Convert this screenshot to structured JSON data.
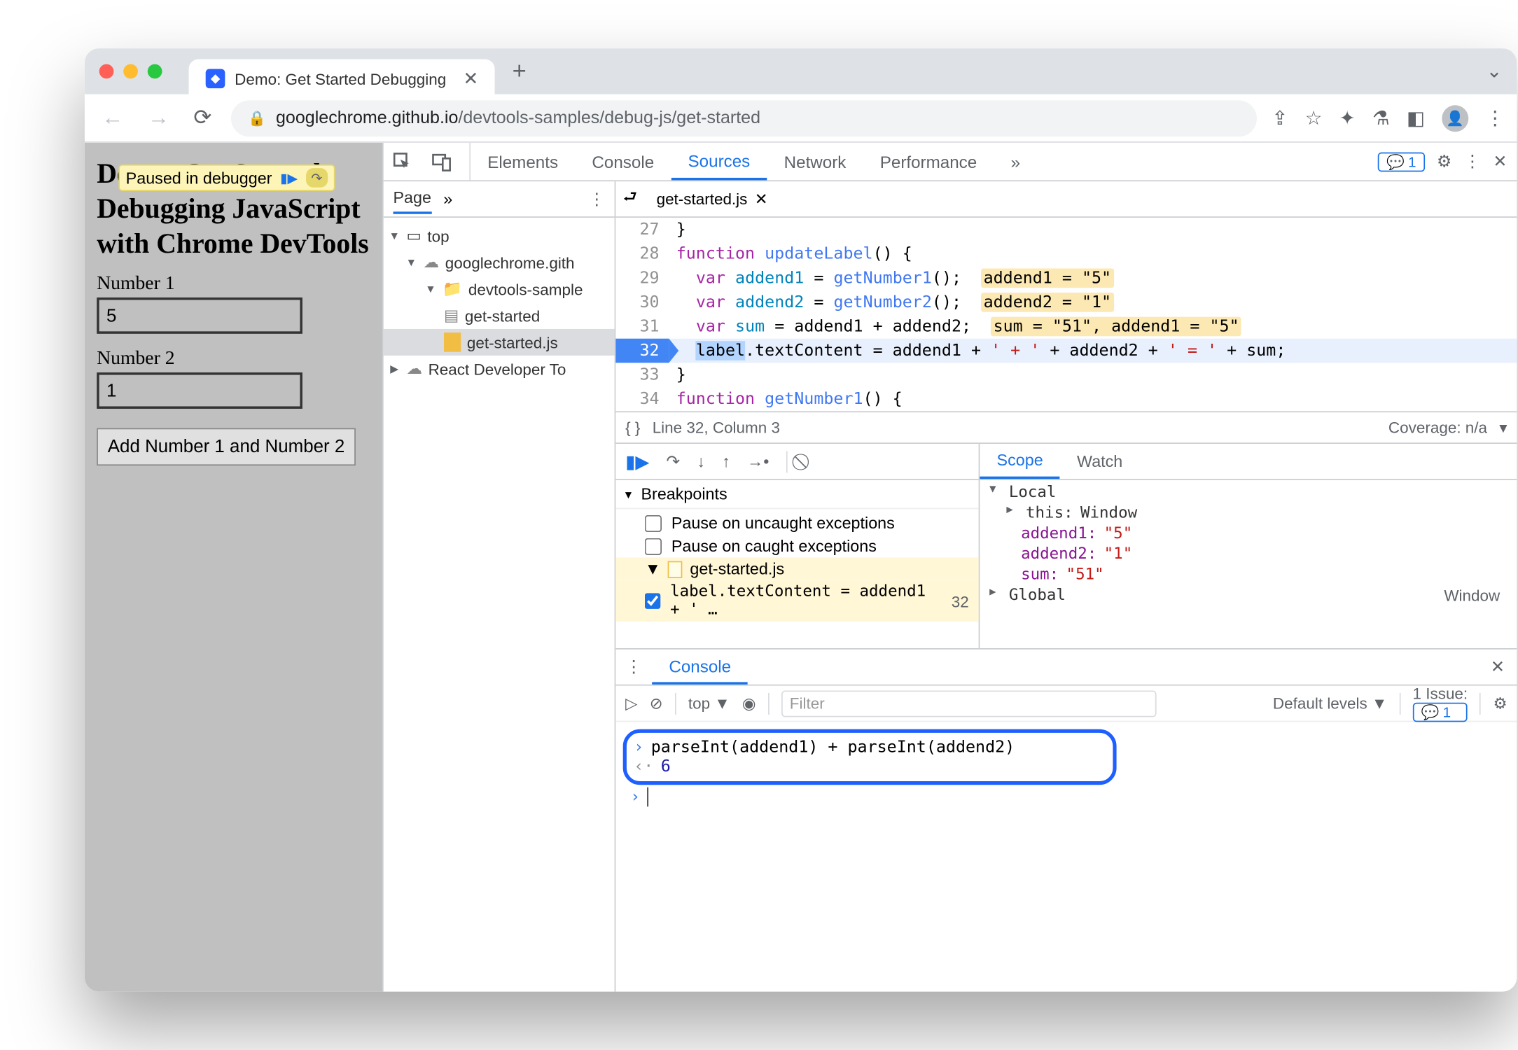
{
  "browser": {
    "tab_title": "Demo: Get Started Debugging",
    "url_host": "googlechrome.github.io",
    "url_path": "/devtools-samples/debug-js/get-started"
  },
  "paused_badge": "Paused in debugger",
  "page": {
    "heading": "Demo: Get Started Debugging JavaScript with Chrome DevTools",
    "label1": "Number 1",
    "value1": "5",
    "label2": "Number 2",
    "value2": "1",
    "button": "Add Number 1 and Number 2"
  },
  "devtools": {
    "tabs": [
      "Elements",
      "Console",
      "Sources",
      "Network",
      "Performance"
    ],
    "active_tab": "Sources",
    "issue_count": "1"
  },
  "nav": {
    "head": "Page",
    "top": "top",
    "domain": "googlechrome.gith",
    "folder": "devtools-sample",
    "file_html": "get-started",
    "file_js": "get-started.js",
    "react": "React Developer To"
  },
  "editor": {
    "open_file": "get-started.js",
    "coverage": "Coverage: n/a",
    "cursor": "Line 32, Column 3",
    "lines": [
      {
        "n": "27",
        "html": "}"
      },
      {
        "n": "28",
        "html": "<span class='kw'>function</span> <span class='fn'>updateLabel</span>() {"
      },
      {
        "n": "29",
        "html": "  <span class='kw'>var</span> <span class='var'>addend1</span> = <span class='fn'>getNumber1</span>();  <span class='hl'>addend1 = \"5\"</span>"
      },
      {
        "n": "30",
        "html": "  <span class='kw'>var</span> <span class='var'>addend2</span> = <span class='fn'>getNumber2</span>();  <span class='hl'>addend2 = \"1\"</span>"
      },
      {
        "n": "31",
        "html": "  <span class='kw'>var</span> <span class='var'>sum</span> = addend1 + addend2;  <span class='hl'>sum = \"51\", addend1 = \"5\"</span>"
      },
      {
        "n": "32",
        "html": "  <span class='sel-token'>label</span>.textContent = addend1 + <span class='str'>' + '</span> + addend2 + <span class='str'>' = '</span> + sum;",
        "cur": true
      },
      {
        "n": "33",
        "html": "}"
      },
      {
        "n": "34",
        "html": "<span class='kw'>function</span> <span class='fn'>getNumber1</span>() {"
      }
    ]
  },
  "debugger": {
    "breakpoints": "Breakpoints",
    "pause_uncaught": "Pause on uncaught exceptions",
    "pause_caught": "Pause on caught exceptions",
    "bp_file": "get-started.js",
    "bp_text": "label.textContent = addend1 + ' …",
    "bp_line": "32"
  },
  "scope": {
    "tabs": [
      "Scope",
      "Watch"
    ],
    "local": "Local",
    "this_label": "this:",
    "this_val": "Window",
    "vars": [
      {
        "k": "addend1:",
        "v": "\"5\""
      },
      {
        "k": "addend2:",
        "v": "\"1\""
      },
      {
        "k": "sum:",
        "v": "\"51\""
      }
    ],
    "global": "Global",
    "global_val": "Window"
  },
  "console": {
    "title": "Console",
    "context": "top",
    "filter": "Filter",
    "levels": "Default levels",
    "issue_label": "1 Issue:",
    "issue_count": "1",
    "expr": "parseInt(addend1) + parseInt(addend2)",
    "result": "6"
  }
}
